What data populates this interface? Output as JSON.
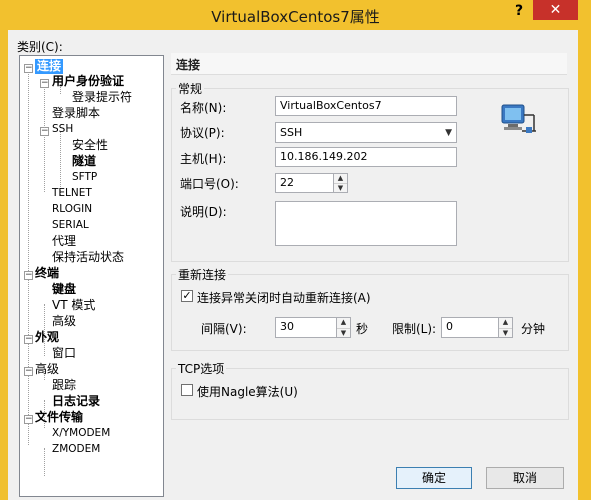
{
  "window": {
    "title": "VirtualBoxCentos7属性",
    "help_glyph": "?",
    "close_glyph": "✕"
  },
  "category_label": "类别(C):",
  "tree": [
    {
      "label": "连接",
      "expander": "−"
    },
    {
      "label": "用户身份验证",
      "expander": "−"
    },
    {
      "label": "登录提示符"
    },
    {
      "label": "登录脚本"
    },
    {
      "label": "SSH",
      "expander": "−"
    },
    {
      "label": "安全性"
    },
    {
      "label": "隧道"
    },
    {
      "label": "SFTP"
    },
    {
      "label": "TELNET"
    },
    {
      "label": "RLOGIN"
    },
    {
      "label": "SERIAL"
    },
    {
      "label": "代理"
    },
    {
      "label": "保持活动状态"
    },
    {
      "label": "终端",
      "expander": "−"
    },
    {
      "label": "键盘"
    },
    {
      "label": "VT 模式"
    },
    {
      "label": "高级"
    },
    {
      "label": "外观",
      "expander": "−"
    },
    {
      "label": "窗口"
    },
    {
      "label": "高级",
      "expander": "−"
    },
    {
      "label": "跟踪"
    },
    {
      "label": "日志记录"
    },
    {
      "label": "文件传输",
      "expander": "−"
    },
    {
      "label": "X/YMODEM"
    },
    {
      "label": "ZMODEM"
    }
  ],
  "panel_title": "连接",
  "general": {
    "title": "常规",
    "name_label": "名称(N):",
    "name_value": "VirtualBoxCentos7",
    "protocol_label": "协议(P):",
    "protocol_value": "SSH",
    "host_label": "主机(H):",
    "host_value": "10.186.149.202",
    "port_label": "端口号(O):",
    "port_value": "22",
    "desc_label": "说明(D):",
    "desc_value": ""
  },
  "reconnect": {
    "title": "重新连接",
    "auto_label": "连接异常关闭时自动重新连接(A)",
    "auto_checked": true,
    "interval_label": "间隔(V):",
    "interval_value": "30",
    "interval_unit": "秒",
    "limit_label": "限制(L):",
    "limit_value": "0",
    "limit_unit": "分钟"
  },
  "tcp": {
    "title": "TCP选项",
    "nagle_label": "使用Nagle算法(U)",
    "nagle_checked": false
  },
  "buttons": {
    "ok": "确定",
    "cancel": "取消"
  },
  "colors": {
    "titlebar": "#f2c12e",
    "selection": "#3399ff",
    "close": "#c7312a"
  }
}
